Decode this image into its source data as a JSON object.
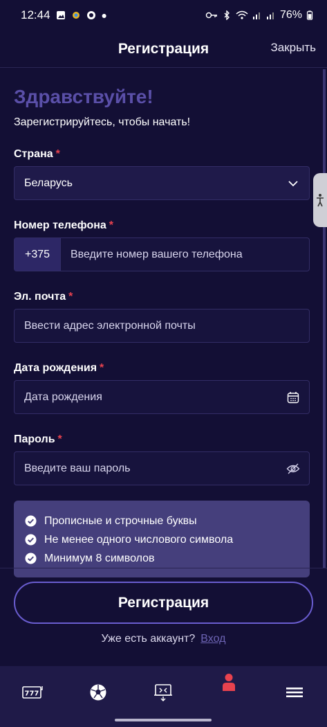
{
  "status_bar": {
    "time": "12:44",
    "battery": "76%"
  },
  "header": {
    "title": "Регистрация",
    "close_label": "Закрыть"
  },
  "greeting": "Здравствуйте!",
  "subtitle": "Зарегистрируйтесь, чтобы начать!",
  "fields": {
    "country": {
      "label": "Страна",
      "required": "*",
      "value": "Беларусь"
    },
    "phone": {
      "label": "Номер телефона",
      "required": "*",
      "prefix": "+375",
      "placeholder": "Введите номер вашего телефона"
    },
    "email": {
      "label": "Эл. почта",
      "required": "*",
      "placeholder": "Ввести адрес электронной почты"
    },
    "birthdate": {
      "label": "Дата рождения",
      "required": "*",
      "placeholder": "Дата рождения"
    },
    "password": {
      "label": "Пароль",
      "required": "*",
      "placeholder": "Введите ваш пароль"
    }
  },
  "password_rules": [
    "Прописные и строчные буквы",
    "Не менее одного числового символа",
    "Минимум 8 символов"
  ],
  "register_button": "Регистрация",
  "login_prompt": "Уже есть аккаунт?",
  "login_link": "Вход",
  "bottom_nav": [
    {
      "icon": "slot-machine-icon"
    },
    {
      "icon": "soccer-ball-icon"
    },
    {
      "icon": "live-screen-icon"
    },
    {
      "icon": "user-icon",
      "color": "#e8424e"
    },
    {
      "icon": "menu-icon"
    }
  ],
  "colors": {
    "background": "#130f35",
    "accent": "#6a5dd0",
    "required": "#e8424e",
    "greeting": "#5a4fa8"
  }
}
